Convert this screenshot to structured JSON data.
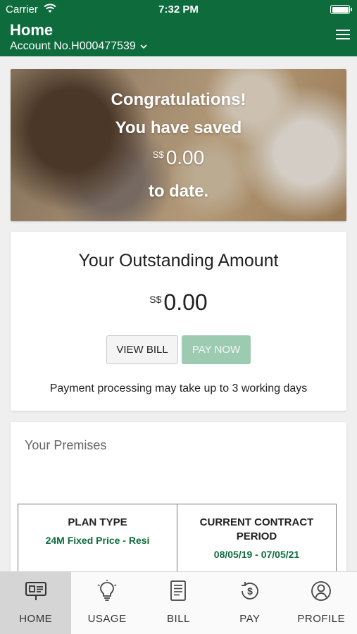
{
  "status_bar": {
    "carrier": "Carrier",
    "time": "7:32 PM"
  },
  "header": {
    "title": "Home",
    "account": "Account No.H000477539"
  },
  "hero": {
    "line1": "Congratulations!",
    "line2": "You have saved",
    "currency": "S$",
    "amount": "0.00",
    "line4": "to date."
  },
  "outstanding": {
    "title": "Your Outstanding Amount",
    "currency": "S$",
    "amount": "0.00",
    "view_bill_label": "VIEW BILL",
    "pay_now_label": "PAY NOW",
    "note": "Payment processing may take up to 3 working days"
  },
  "premises": {
    "title": "Your Premises",
    "columns": [
      {
        "header": "PLAN TYPE",
        "value": "24M Fixed Price - Resi"
      },
      {
        "header": "CURRENT CONTRACT PERIOD",
        "value": "08/05/19 - 07/05/21"
      }
    ]
  },
  "tabs": [
    {
      "label": "HOME",
      "icon": "home-dashboard-icon",
      "active": true
    },
    {
      "label": "USAGE",
      "icon": "lightbulb-icon",
      "active": false
    },
    {
      "label": "BILL",
      "icon": "bill-document-icon",
      "active": false
    },
    {
      "label": "PAY",
      "icon": "pay-dollar-icon",
      "active": false
    },
    {
      "label": "PROFILE",
      "icon": "profile-person-icon",
      "active": false
    }
  ],
  "colors": {
    "brand": "#0d6b3c",
    "pay_button": "#9ccbb2",
    "active_tab": "#d5d5d5"
  }
}
